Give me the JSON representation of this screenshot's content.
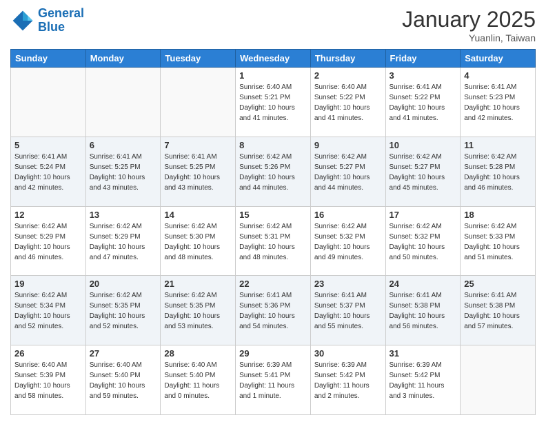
{
  "header": {
    "logo_line1": "General",
    "logo_line2": "Blue",
    "month_title": "January 2025",
    "location": "Yuanlin, Taiwan"
  },
  "days_of_week": [
    "Sunday",
    "Monday",
    "Tuesday",
    "Wednesday",
    "Thursday",
    "Friday",
    "Saturday"
  ],
  "weeks": [
    [
      {
        "num": "",
        "sunrise": "",
        "sunset": "",
        "daylight": ""
      },
      {
        "num": "",
        "sunrise": "",
        "sunset": "",
        "daylight": ""
      },
      {
        "num": "",
        "sunrise": "",
        "sunset": "",
        "daylight": ""
      },
      {
        "num": "1",
        "sunrise": "6:40 AM",
        "sunset": "5:21 PM",
        "daylight": "10 hours and 41 minutes."
      },
      {
        "num": "2",
        "sunrise": "6:40 AM",
        "sunset": "5:22 PM",
        "daylight": "10 hours and 41 minutes."
      },
      {
        "num": "3",
        "sunrise": "6:41 AM",
        "sunset": "5:22 PM",
        "daylight": "10 hours and 41 minutes."
      },
      {
        "num": "4",
        "sunrise": "6:41 AM",
        "sunset": "5:23 PM",
        "daylight": "10 hours and 42 minutes."
      }
    ],
    [
      {
        "num": "5",
        "sunrise": "6:41 AM",
        "sunset": "5:24 PM",
        "daylight": "10 hours and 42 minutes."
      },
      {
        "num": "6",
        "sunrise": "6:41 AM",
        "sunset": "5:25 PM",
        "daylight": "10 hours and 43 minutes."
      },
      {
        "num": "7",
        "sunrise": "6:41 AM",
        "sunset": "5:25 PM",
        "daylight": "10 hours and 43 minutes."
      },
      {
        "num": "8",
        "sunrise": "6:42 AM",
        "sunset": "5:26 PM",
        "daylight": "10 hours and 44 minutes."
      },
      {
        "num": "9",
        "sunrise": "6:42 AM",
        "sunset": "5:27 PM",
        "daylight": "10 hours and 44 minutes."
      },
      {
        "num": "10",
        "sunrise": "6:42 AM",
        "sunset": "5:27 PM",
        "daylight": "10 hours and 45 minutes."
      },
      {
        "num": "11",
        "sunrise": "6:42 AM",
        "sunset": "5:28 PM",
        "daylight": "10 hours and 46 minutes."
      }
    ],
    [
      {
        "num": "12",
        "sunrise": "6:42 AM",
        "sunset": "5:29 PM",
        "daylight": "10 hours and 46 minutes."
      },
      {
        "num": "13",
        "sunrise": "6:42 AM",
        "sunset": "5:29 PM",
        "daylight": "10 hours and 47 minutes."
      },
      {
        "num": "14",
        "sunrise": "6:42 AM",
        "sunset": "5:30 PM",
        "daylight": "10 hours and 48 minutes."
      },
      {
        "num": "15",
        "sunrise": "6:42 AM",
        "sunset": "5:31 PM",
        "daylight": "10 hours and 48 minutes."
      },
      {
        "num": "16",
        "sunrise": "6:42 AM",
        "sunset": "5:32 PM",
        "daylight": "10 hours and 49 minutes."
      },
      {
        "num": "17",
        "sunrise": "6:42 AM",
        "sunset": "5:32 PM",
        "daylight": "10 hours and 50 minutes."
      },
      {
        "num": "18",
        "sunrise": "6:42 AM",
        "sunset": "5:33 PM",
        "daylight": "10 hours and 51 minutes."
      }
    ],
    [
      {
        "num": "19",
        "sunrise": "6:42 AM",
        "sunset": "5:34 PM",
        "daylight": "10 hours and 52 minutes."
      },
      {
        "num": "20",
        "sunrise": "6:42 AM",
        "sunset": "5:35 PM",
        "daylight": "10 hours and 52 minutes."
      },
      {
        "num": "21",
        "sunrise": "6:42 AM",
        "sunset": "5:35 PM",
        "daylight": "10 hours and 53 minutes."
      },
      {
        "num": "22",
        "sunrise": "6:41 AM",
        "sunset": "5:36 PM",
        "daylight": "10 hours and 54 minutes."
      },
      {
        "num": "23",
        "sunrise": "6:41 AM",
        "sunset": "5:37 PM",
        "daylight": "10 hours and 55 minutes."
      },
      {
        "num": "24",
        "sunrise": "6:41 AM",
        "sunset": "5:38 PM",
        "daylight": "10 hours and 56 minutes."
      },
      {
        "num": "25",
        "sunrise": "6:41 AM",
        "sunset": "5:38 PM",
        "daylight": "10 hours and 57 minutes."
      }
    ],
    [
      {
        "num": "26",
        "sunrise": "6:40 AM",
        "sunset": "5:39 PM",
        "daylight": "10 hours and 58 minutes."
      },
      {
        "num": "27",
        "sunrise": "6:40 AM",
        "sunset": "5:40 PM",
        "daylight": "10 hours and 59 minutes."
      },
      {
        "num": "28",
        "sunrise": "6:40 AM",
        "sunset": "5:40 PM",
        "daylight": "11 hours and 0 minutes."
      },
      {
        "num": "29",
        "sunrise": "6:39 AM",
        "sunset": "5:41 PM",
        "daylight": "11 hours and 1 minute."
      },
      {
        "num": "30",
        "sunrise": "6:39 AM",
        "sunset": "5:42 PM",
        "daylight": "11 hours and 2 minutes."
      },
      {
        "num": "31",
        "sunrise": "6:39 AM",
        "sunset": "5:42 PM",
        "daylight": "11 hours and 3 minutes."
      },
      {
        "num": "",
        "sunrise": "",
        "sunset": "",
        "daylight": ""
      }
    ]
  ],
  "labels": {
    "sunrise_prefix": "Sunrise: ",
    "sunset_prefix": "Sunset: ",
    "daylight_prefix": "Daylight: "
  }
}
